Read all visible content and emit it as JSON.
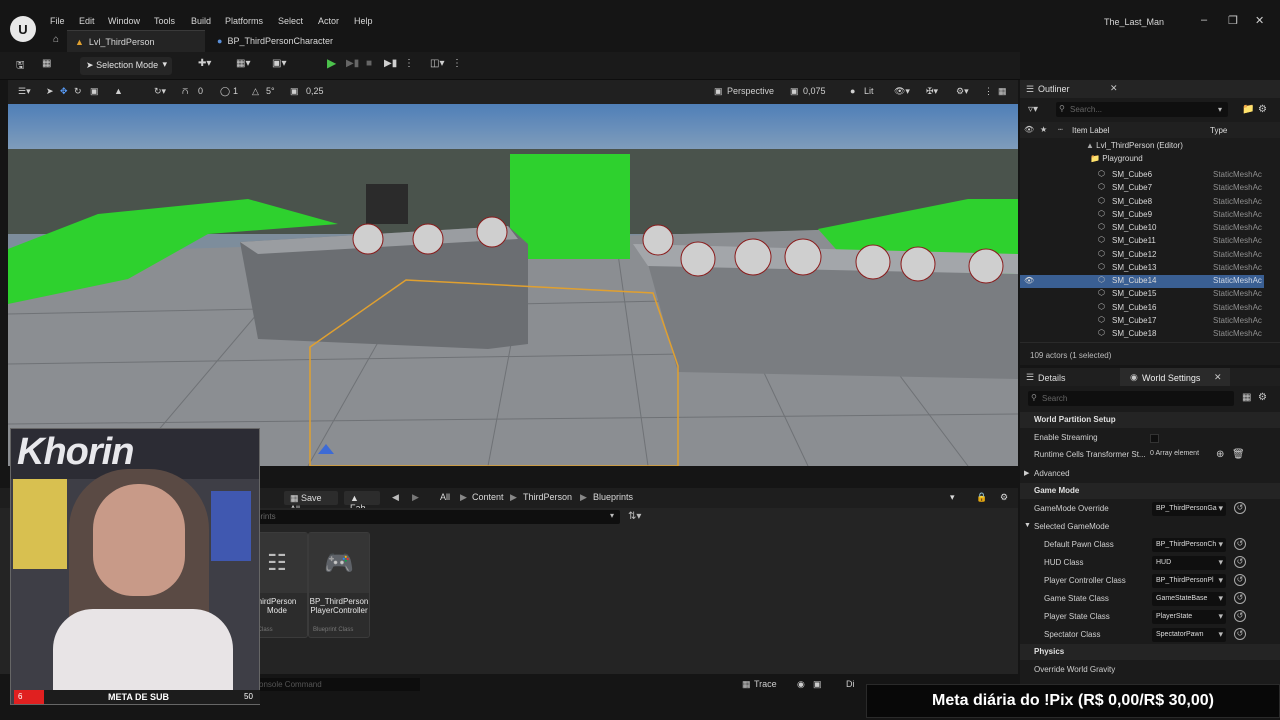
{
  "app": {
    "title": "The_Last_Man",
    "logo": "U",
    "menu": [
      "File",
      "Edit",
      "Window",
      "Tools",
      "Build",
      "Platforms",
      "Select",
      "Actor",
      "Help"
    ]
  },
  "tabs": [
    {
      "label": "Lvl_ThirdPerson",
      "icon": "level-icon",
      "active": true
    },
    {
      "label": "BP_ThirdPersonCharacter",
      "icon": "blueprint-icon",
      "active": false
    }
  ],
  "toolbar": {
    "selection_mode": "Selection Mode"
  },
  "viewport_bar": {
    "rotation_snap": "0",
    "grid_snap": "1",
    "angle_snap": "5°",
    "scale_snap": "0,25",
    "view_mode": "Perspective",
    "camera_speed": "0,075",
    "lighting_mode": "Lit"
  },
  "content_browser": {
    "save_all": "Save All",
    "fab": "Fab",
    "breadcrumbs": [
      "All",
      "Content",
      "ThirdPerson",
      "Blueprints"
    ],
    "search_placeholder": "prints",
    "assets": [
      {
        "name": "hirdPerson Mode",
        "class": "nt Class"
      },
      {
        "name": "BP_ThirdPerson PlayerController",
        "class": "Blueprint Class"
      }
    ],
    "console_placeholder": "onsole Command",
    "trace": "Trace",
    "status_left": "Di"
  },
  "outliner": {
    "title": "Outliner",
    "search_placeholder": "Search...",
    "col_label": "Item Label",
    "col_type": "Type",
    "root": "Lvl_ThirdPerson (Editor)",
    "folder": "Playground",
    "rows": [
      {
        "name": "SM_Cube6",
        "type": "StaticMeshAc",
        "selected": false
      },
      {
        "name": "SM_Cube7",
        "type": "StaticMeshAc",
        "selected": false
      },
      {
        "name": "SM_Cube8",
        "type": "StaticMeshAc",
        "selected": false
      },
      {
        "name": "SM_Cube9",
        "type": "StaticMeshAc",
        "selected": false
      },
      {
        "name": "SM_Cube10",
        "type": "StaticMeshAc",
        "selected": false
      },
      {
        "name": "SM_Cube11",
        "type": "StaticMeshAc",
        "selected": false
      },
      {
        "name": "SM_Cube12",
        "type": "StaticMeshAc",
        "selected": false
      },
      {
        "name": "SM_Cube13",
        "type": "StaticMeshAc",
        "selected": false
      },
      {
        "name": "SM_Cube14",
        "type": "StaticMeshAc",
        "selected": true
      },
      {
        "name": "SM_Cube15",
        "type": "StaticMeshAc",
        "selected": false
      },
      {
        "name": "SM_Cube16",
        "type": "StaticMeshAc",
        "selected": false
      },
      {
        "name": "SM_Cube17",
        "type": "StaticMeshAc",
        "selected": false
      },
      {
        "name": "SM_Cube18",
        "type": "StaticMeshAc",
        "selected": false
      }
    ],
    "count": "109 actors (1 selected)"
  },
  "details": {
    "tab_details": "Details",
    "tab_world": "World Settings",
    "search_placeholder": "Search",
    "sections": {
      "world_partition": "World Partition Setup",
      "enable_streaming": "Enable Streaming",
      "runtime_cells": "Runtime Cells Transformer St...",
      "array_value": "0 Array element",
      "advanced": "Advanced",
      "game_mode": "Game Mode",
      "gamemode_override": "GameMode Override",
      "gamemode_override_value": "BP_ThirdPersonGa",
      "selected_gamemode": "Selected GameMode",
      "default_pawn": "Default Pawn Class",
      "default_pawn_value": "BP_ThirdPersonCh",
      "hud": "HUD Class",
      "hud_value": "HUD",
      "player_controller": "Player Controller Class",
      "player_controller_value": "BP_ThirdPersonPl",
      "game_state": "Game State Class",
      "game_state_value": "GameStateBase",
      "player_state": "Player State Class",
      "player_state_value": "PlayerState",
      "spectator": "Spectator Class",
      "spectator_value": "SpectatorPawn",
      "physics": "Physics",
      "override_gravity": "Override World Gravity"
    }
  },
  "overlay": {
    "sub_goal": "META DE SUB",
    "sub_current": "6",
    "sub_target": "50",
    "pix_goal": "Meta diária do !Pix (R$ 0,00/R$ 30,00)",
    "banner_text": "Khorin"
  },
  "colors": {
    "accent_green": "#30d030",
    "selection_blue": "#3a5f93",
    "selection_box": "#e0a030"
  }
}
